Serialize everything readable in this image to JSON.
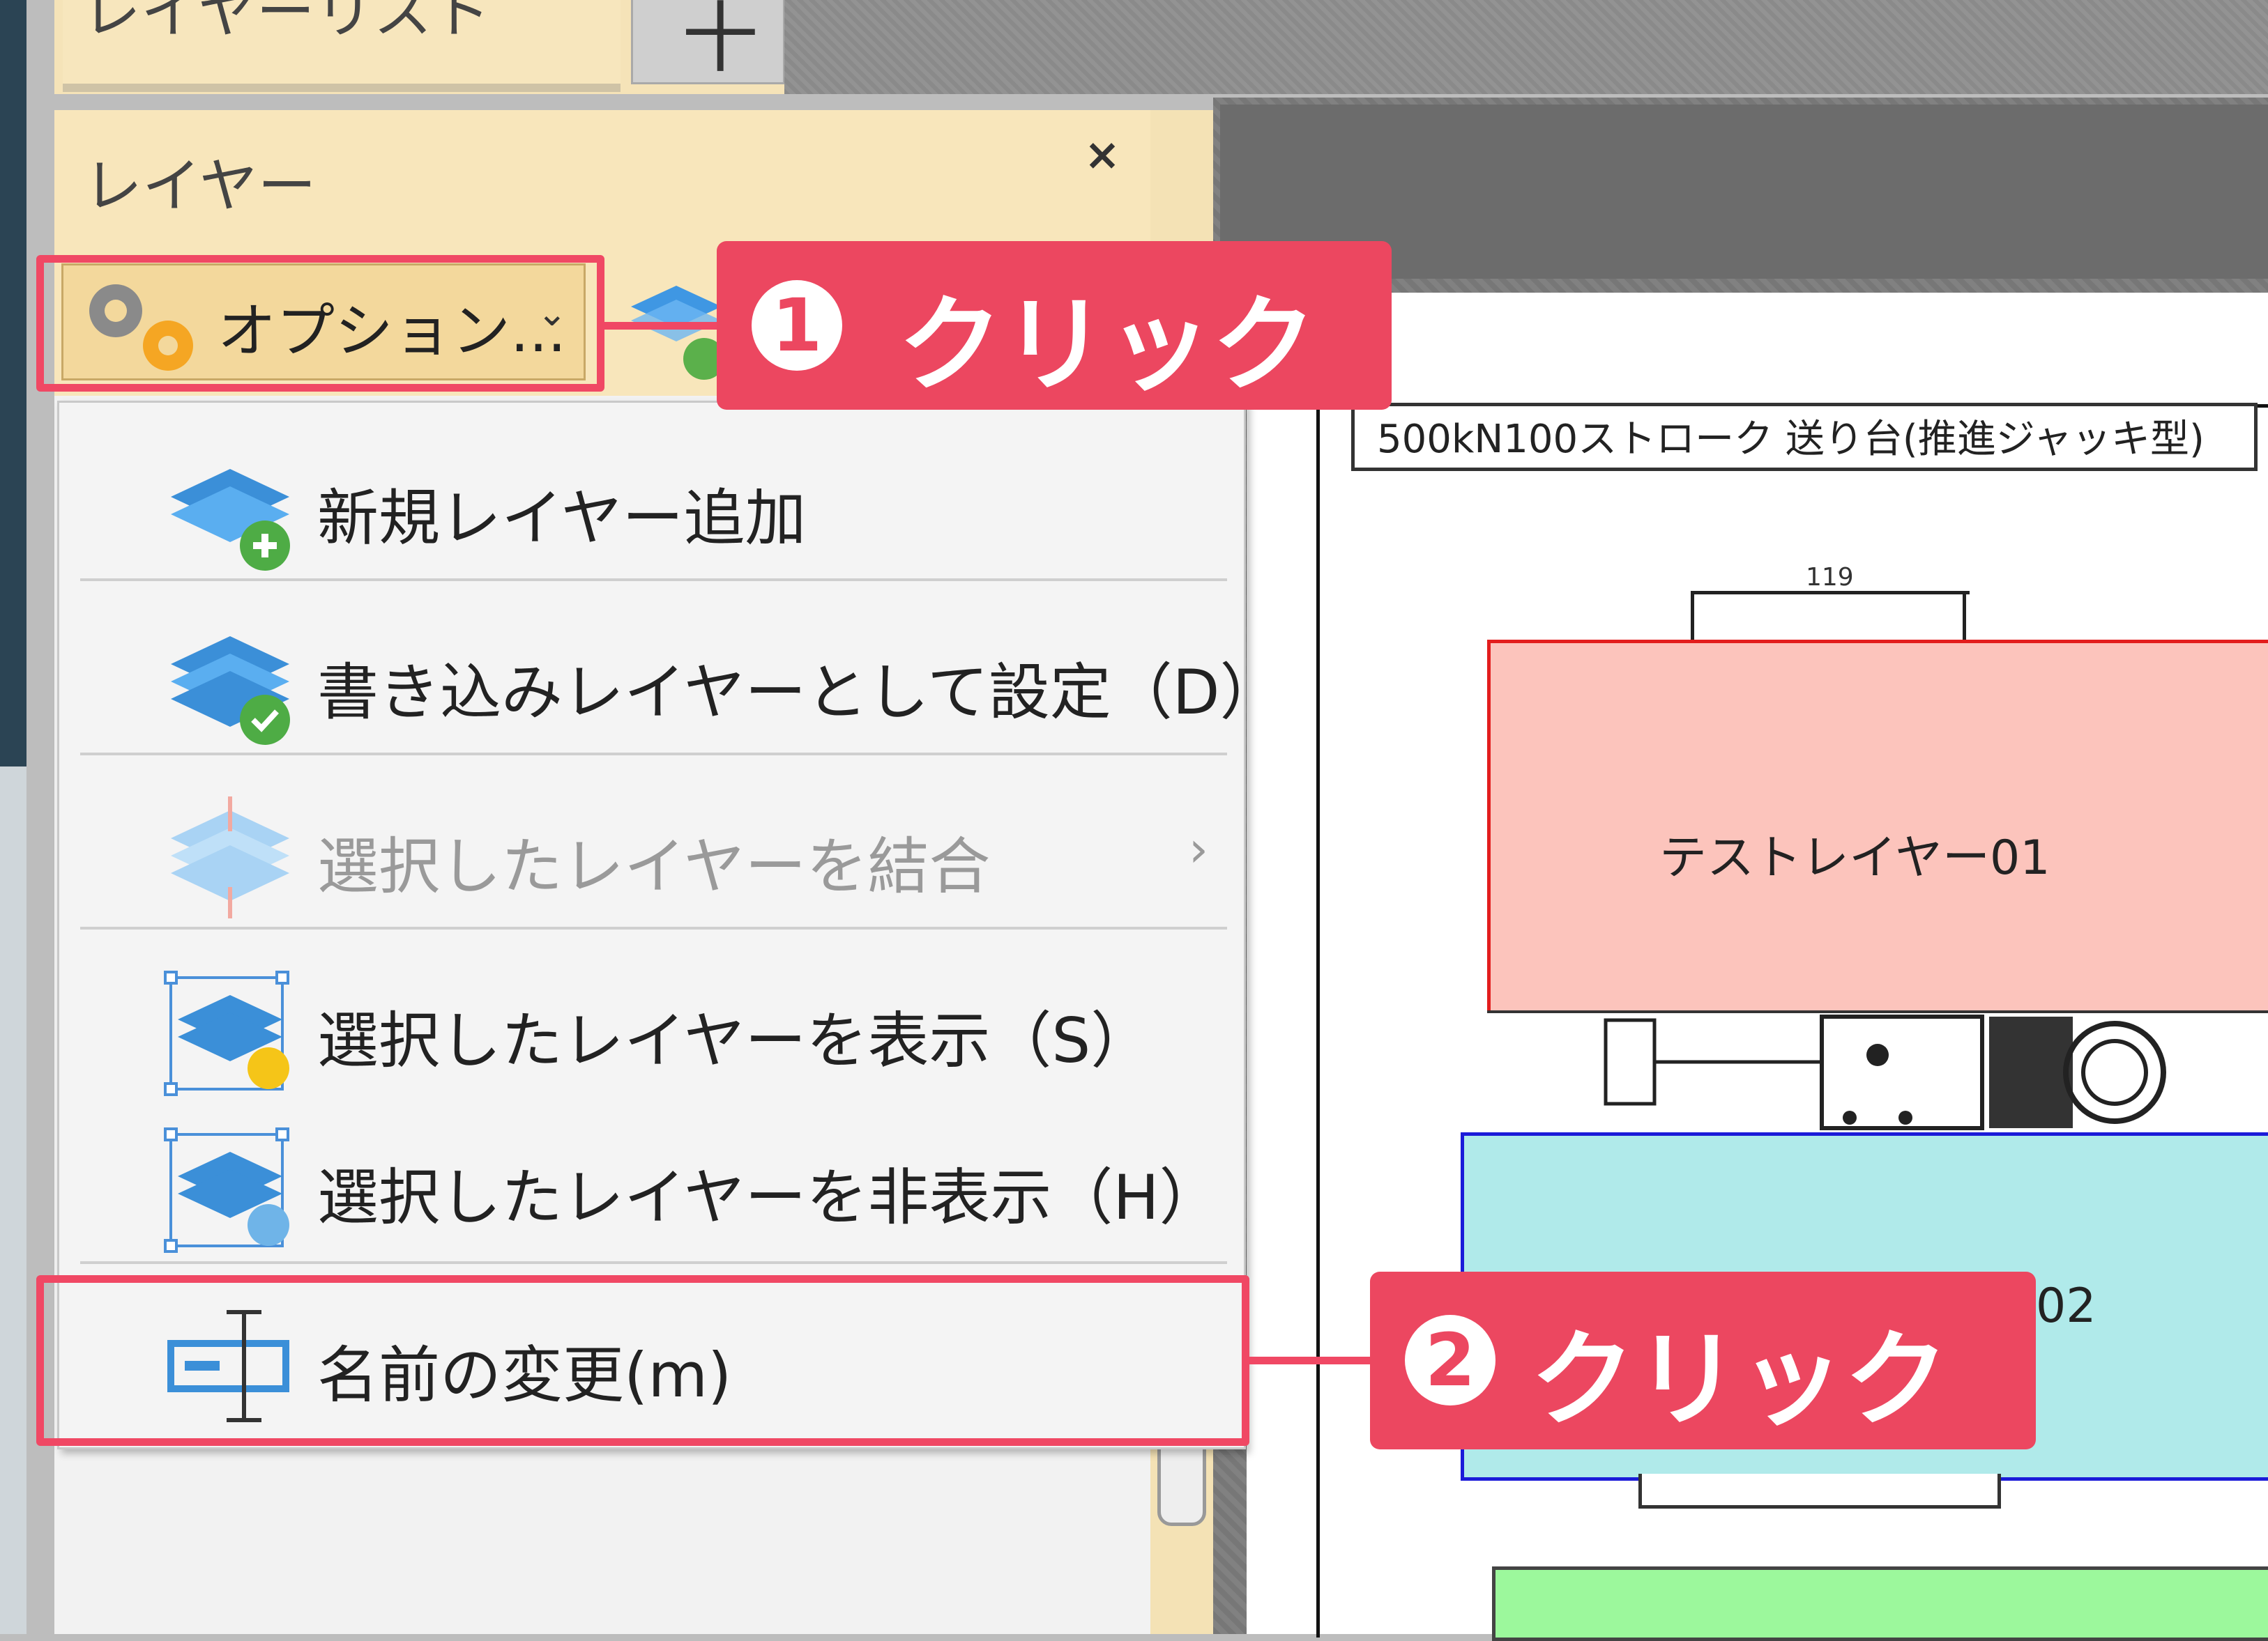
{
  "tabs": {
    "layer_list": "レイヤーリスト",
    "add": "十"
  },
  "panel": {
    "title": "レイヤー",
    "close": "×"
  },
  "toolbar": {
    "options_label": "オプション...",
    "options_chevron": "⌄"
  },
  "menu": {
    "items": [
      {
        "label": "新規レイヤー追加",
        "icon": "layer-add-icon",
        "enabled": true
      },
      {
        "label": "書き込みレイヤーとして設定（D）",
        "icon": "layer-check-icon",
        "enabled": true
      },
      {
        "label": "選択したレイヤーを結合",
        "icon": "layer-merge-icon",
        "enabled": false,
        "submenu": "›"
      },
      {
        "label": "選択したレイヤーを表示（S）",
        "icon": "layer-show-icon",
        "enabled": true
      },
      {
        "label": "選択したレイヤーを非表示（H）",
        "icon": "layer-hide-icon",
        "enabled": true
      },
      {
        "label": "名前の変更(m)",
        "icon": "rename-icon",
        "enabled": true
      }
    ]
  },
  "drawing": {
    "title": "500kN100ストローク 送り台(推進ジャッキ型)",
    "dimension": "119",
    "layers": [
      {
        "label": "テストレイヤー01",
        "fill": "#fcc4bc",
        "stroke": "#e31d1d"
      },
      {
        "label": "02",
        "fill": "#b0eaea",
        "stroke": "#1b1bd9"
      },
      {
        "label": "",
        "fill": "#9cf89c",
        "stroke": "#444444"
      }
    ]
  },
  "annotations": [
    {
      "number": "1",
      "text": "クリック"
    },
    {
      "number": "2",
      "text": "クリック"
    }
  ],
  "colors": {
    "accent": "#ec4760",
    "panel_header": "#f8e6bb"
  }
}
